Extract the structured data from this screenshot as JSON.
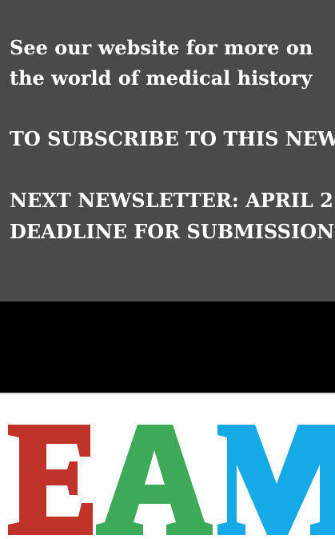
{
  "newsletter_footer": {
    "website_line_1": "See our website for more on",
    "website_line_2": "the world of medical history",
    "subscribe_line": "TO SUBSCRIBE TO THIS NEWSLETTER",
    "next_newsletter_line": "NEXT NEWSLETTER: APRIL 2",
    "deadline_line": "DEADLINE FOR SUBMISSIONS"
  },
  "logo": {
    "letters": [
      "E",
      "A",
      "M"
    ],
    "colors": {
      "E": "#c0332a",
      "A": "#3daa57",
      "M": "#16a9e8"
    }
  },
  "colors": {
    "panel_background": "#4b4a4a",
    "band_background": "#000000",
    "page_background": "#ffffff",
    "text": "#ffffff"
  }
}
